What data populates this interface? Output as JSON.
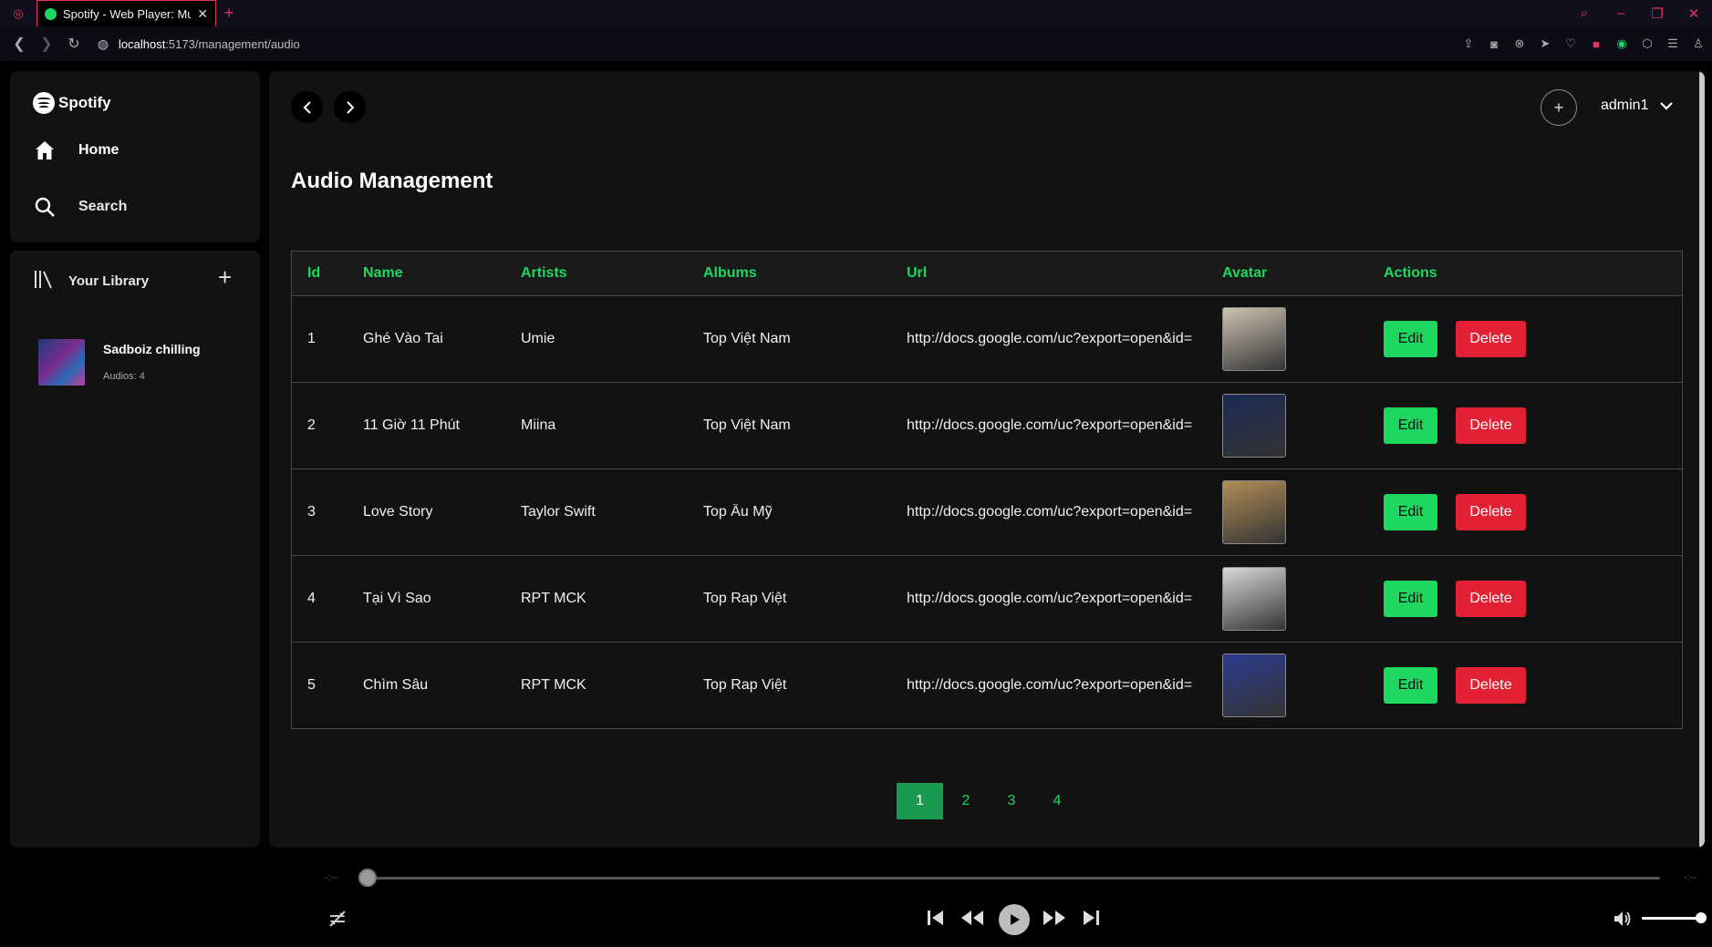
{
  "browser": {
    "tab_title": "Spotify - Web Player: Music",
    "url_host": "localhost",
    "url_path": ":5173/management/audio"
  },
  "sidebar": {
    "logo_text": "Spotify",
    "nav": [
      {
        "label": "Home",
        "icon": "home-icon"
      },
      {
        "label": "Search",
        "icon": "search-icon"
      }
    ],
    "library": {
      "title": "Your Library",
      "playlists": [
        {
          "title": "Sadboiz chilling",
          "subtitle": "Audios: 4"
        }
      ]
    }
  },
  "header": {
    "username": "admin1"
  },
  "page": {
    "title": "Audio Management"
  },
  "table": {
    "columns": [
      "Id",
      "Name",
      "Artists",
      "Albums",
      "Url",
      "Avatar",
      "Actions"
    ],
    "rows": [
      {
        "id": "1",
        "name": "Ghé Vào Tai",
        "artists": "Umie",
        "album": "Top Việt Nam",
        "url": "http://docs.google.com/uc?export=open&id=",
        "avatar_color": "#cfc3b2"
      },
      {
        "id": "2",
        "name": "11 Giờ 11 Phút",
        "artists": "Miina",
        "album": "Top Việt Nam",
        "url": "http://docs.google.com/uc?export=open&id=",
        "avatar_color": "#1c2b57"
      },
      {
        "id": "3",
        "name": "Love Story",
        "artists": "Taylor Swift",
        "album": "Top Âu Mỹ",
        "url": "http://docs.google.com/uc?export=open&id=",
        "avatar_color": "#b28d55"
      },
      {
        "id": "4",
        "name": "Tại Vì Sao",
        "artists": "RPT MCK",
        "album": "Top Rap Việt",
        "url": "http://docs.google.com/uc?export=open&id=",
        "avatar_color": "#d9d9d9"
      },
      {
        "id": "5",
        "name": "Chìm Sâu",
        "artists": "RPT MCK",
        "album": "Top Rap Việt",
        "url": "http://docs.google.com/uc?export=open&id=",
        "avatar_color": "#2c3b8f"
      }
    ],
    "edit_label": "Edit",
    "delete_label": "Delete"
  },
  "pagination": {
    "pages": [
      "1",
      "2",
      "3",
      "4"
    ],
    "current": "1"
  },
  "player": {
    "time_elapsed": "-:--",
    "time_total": "-:--",
    "progress": 0,
    "volume": 0.9
  },
  "colors": {
    "accent": "#1ed760",
    "danger": "#e22134",
    "surface": "#121212"
  }
}
